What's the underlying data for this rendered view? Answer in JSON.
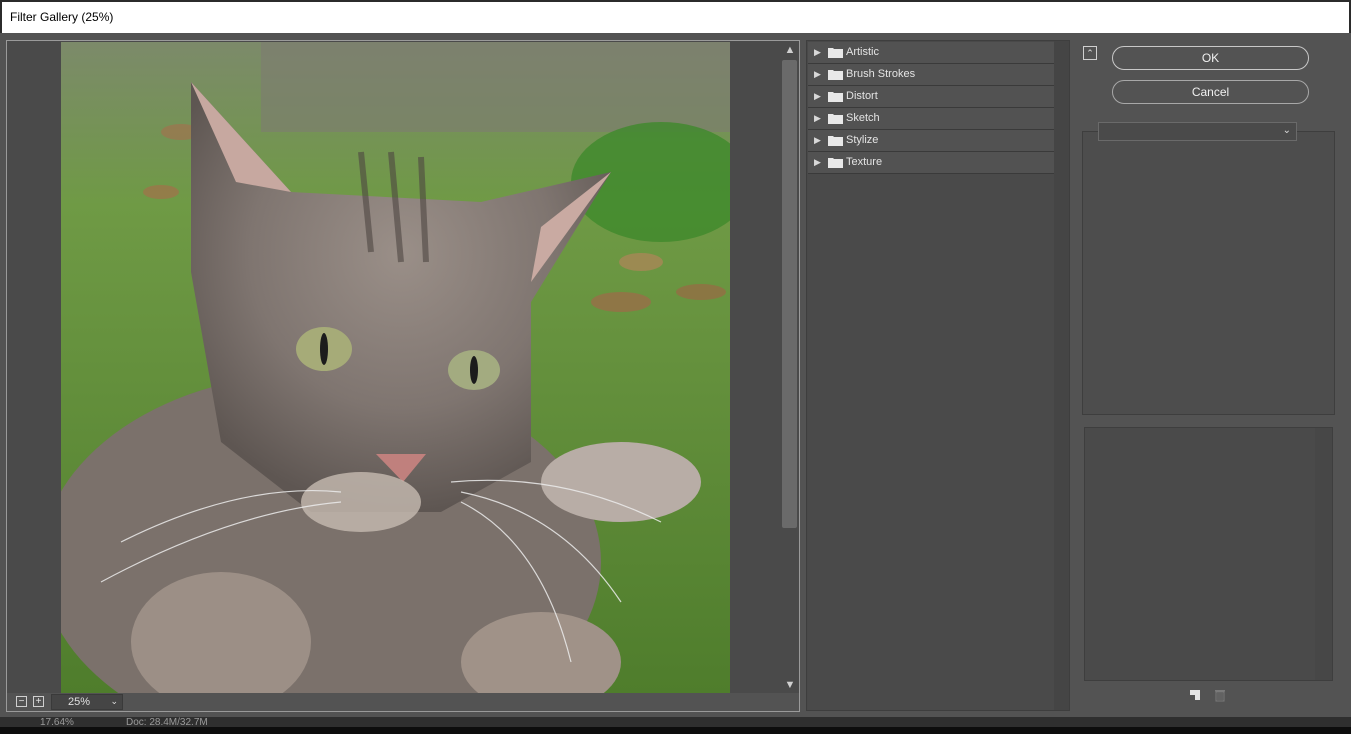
{
  "window": {
    "title": "Filter Gallery (25%)"
  },
  "preview": {
    "zoom_value": "25%",
    "zoom_out_symbol": "−",
    "zoom_in_symbol": "+",
    "scroll_up": "▲",
    "scroll_down": "▼"
  },
  "categories": [
    {
      "label": "Artistic"
    },
    {
      "label": "Brush Strokes"
    },
    {
      "label": "Distort"
    },
    {
      "label": "Sketch"
    },
    {
      "label": "Stylize"
    },
    {
      "label": "Texture"
    }
  ],
  "buttons": {
    "ok": "OK",
    "cancel": "Cancel"
  },
  "filter_select": {
    "value": ""
  },
  "status": {
    "zoom": "17.64%",
    "doc": "Doc: 28.4M/32.7M"
  },
  "icons": [
    "collapse-icon",
    "folder-icon",
    "expand-triangle-icon",
    "new-effect-layer-icon",
    "trash-icon",
    "chevron-down-icon"
  ],
  "colors": {
    "dialog_bg": "#535353",
    "title_bg": "#ffffff",
    "panel_bg": "#4a4a4a"
  }
}
